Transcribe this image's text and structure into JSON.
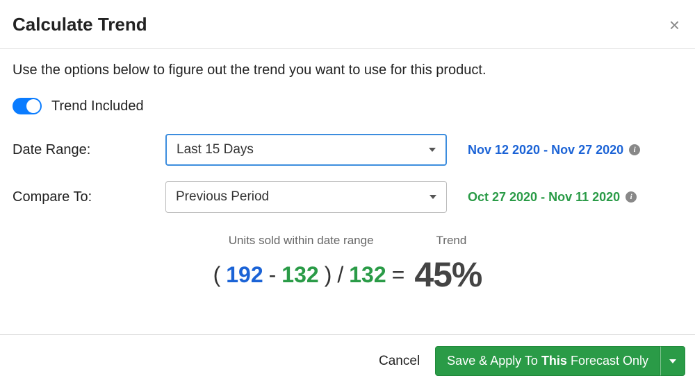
{
  "title": "Calculate Trend",
  "intro": "Use the options below to figure out the trend you want to use for this product.",
  "toggle": {
    "label": "Trend Included",
    "on": true
  },
  "dateRange": {
    "label": "Date Range:",
    "selected": "Last 15 Days",
    "rangeText": "Nov 12 2020 - Nov 27 2020"
  },
  "compareTo": {
    "label": "Compare To:",
    "selected": "Previous Period",
    "rangeText": "Oct 27 2020 - Nov 11 2020"
  },
  "calc": {
    "unitsLabel": "Units sold within date range",
    "trendLabel": "Trend",
    "currentUnits": "192",
    "compareUnits": "132",
    "divisor": "132",
    "result": "45%"
  },
  "footer": {
    "cancel": "Cancel",
    "savePrefix": "Save & Apply To ",
    "saveEmph": "This",
    "saveSuffix": " Forecast Only"
  }
}
